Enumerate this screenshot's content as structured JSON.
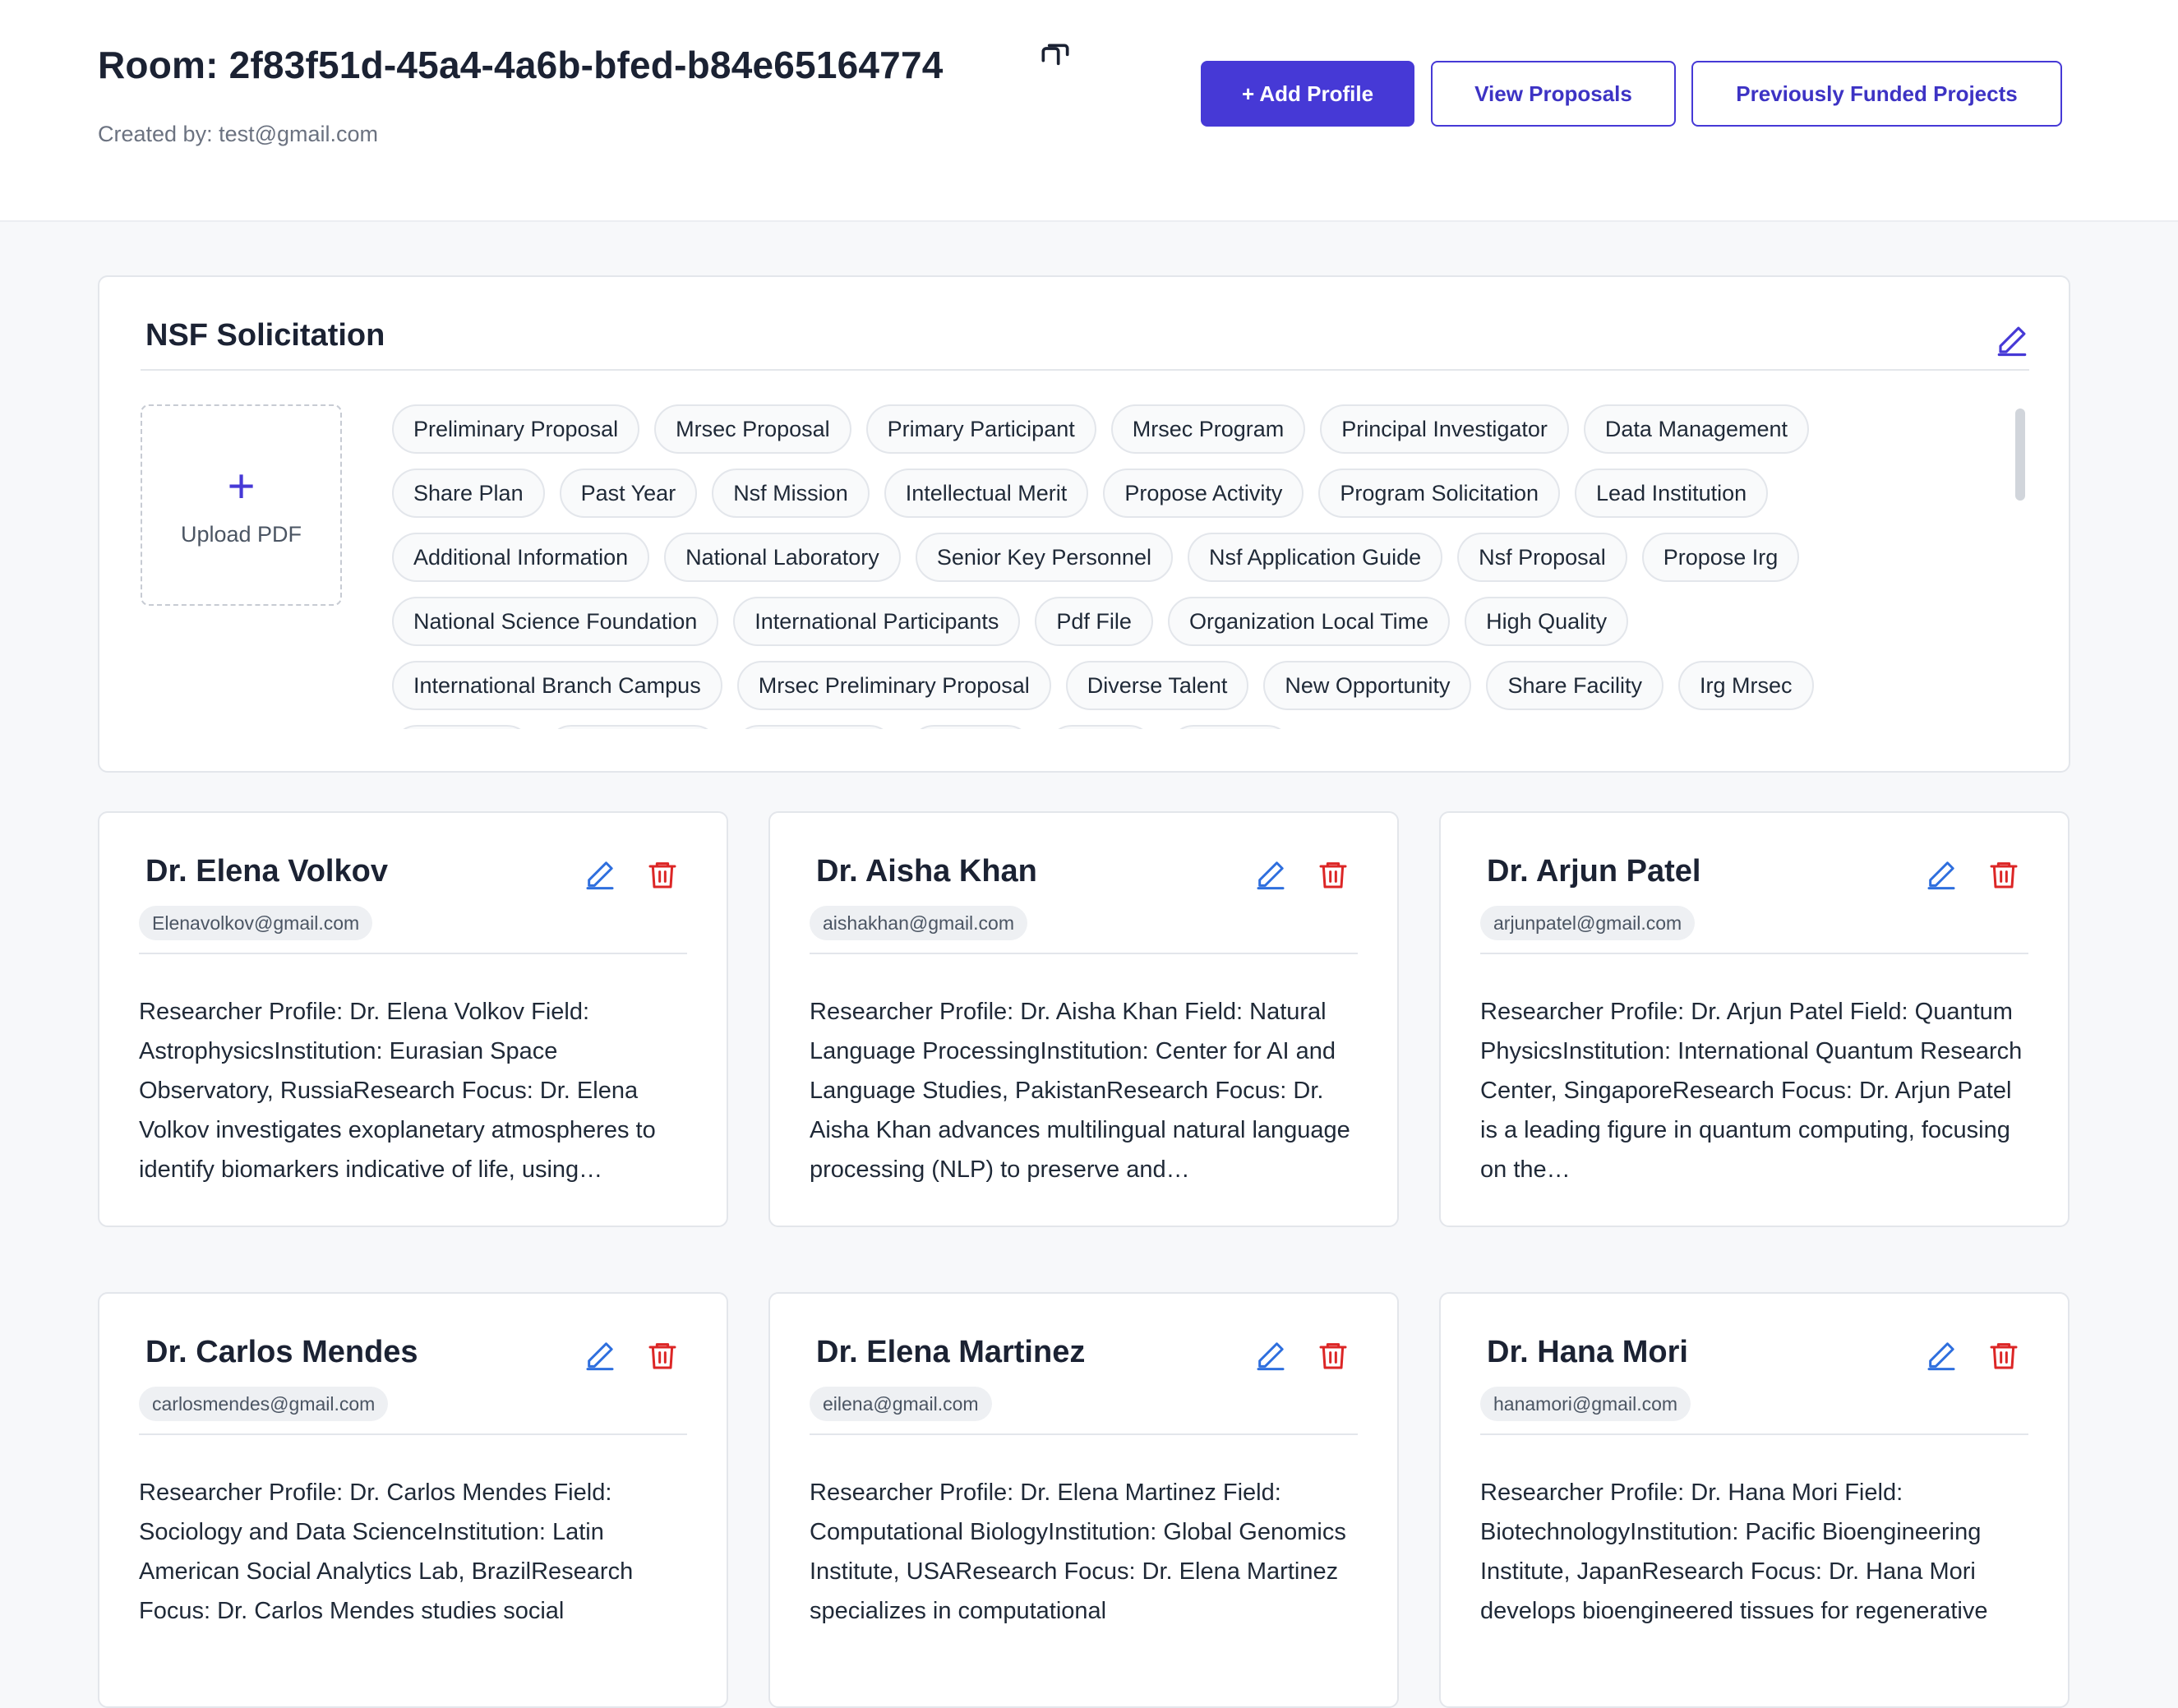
{
  "header": {
    "room_title": "Room: 2f83f51d-45a4-4a6b-bfed-b84e65164774",
    "created_by": "Created by: test@gmail.com",
    "add_profile_label": "+ Add Profile",
    "view_proposals_label": "View Proposals",
    "funded_projects_label": "Previously Funded Projects",
    "accent_color": "#4639d6"
  },
  "solicitation": {
    "title": "NSF Solicitation",
    "upload_plus": "+",
    "upload_label": "Upload PDF",
    "tags": [
      "Preliminary Proposal",
      "Mrsec Proposal",
      "Primary Participant",
      "Mrsec Program",
      "Principal Investigator",
      "Data Management",
      "Share Plan",
      "Past Year",
      "Nsf Mission",
      "Intellectual Merit",
      "Propose Activity",
      "Program Solicitation",
      "Lead Institution",
      "Additional Information",
      "National Laboratory",
      "Senior Key Personnel",
      "Nsf Application Guide",
      "Nsf Proposal",
      "Propose Irg",
      "National Science Foundation",
      "International Participants",
      "Pdf File",
      "Organization Local Time",
      "High Quality",
      "International Branch Campus",
      "Mrsec Preliminary Proposal",
      "Diverse Talent",
      "New Opportunity",
      "Share Facility",
      "Irg Mrsec"
    ]
  },
  "profiles": [
    {
      "name": "Dr. Elena Volkov",
      "email": "Elenavolkov@gmail.com",
      "description": "Researcher Profile: Dr. Elena Volkov Field: AstrophysicsInstitution: Eurasian Space Observatory, RussiaResearch Focus: Dr. Elena Volkov investigates exoplanetary atmospheres to identify biomarkers indicative of life, using…"
    },
    {
      "name": "Dr. Aisha Khan",
      "email": "aishakhan@gmail.com",
      "description": "Researcher Profile: Dr. Aisha Khan Field: Natural Language ProcessingInstitution: Center for AI and Language Studies, PakistanResearch Focus: Dr. Aisha Khan advances multilingual natural language processing (NLP) to preserve and…"
    },
    {
      "name": "Dr. Arjun Patel",
      "email": "arjunpatel@gmail.com",
      "description": "Researcher Profile: Dr. Arjun Patel Field: Quantum PhysicsInstitution: International Quantum Research Center, SingaporeResearch Focus: Dr. Arjun Patel is a leading figure in quantum computing, focusing on the…"
    },
    {
      "name": "Dr. Carlos Mendes",
      "email": "carlosmendes@gmail.com",
      "description": "Researcher Profile: Dr. Carlos Mendes Field: Sociology and Data ScienceInstitution: Latin American Social Analytics Lab, BrazilResearch Focus: Dr. Carlos Mendes studies social"
    },
    {
      "name": "Dr. Elena Martinez",
      "email": "eilena@gmail.com",
      "description": "Researcher Profile: Dr. Elena Martinez Field: Computational BiologyInstitution: Global Genomics Institute, USAResearch Focus: Dr. Elena Martinez specializes in computational"
    },
    {
      "name": "Dr. Hana Mori",
      "email": "hanamori@gmail.com",
      "description": "Researcher Profile: Dr. Hana Mori Field: BiotechnologyInstitution: Pacific Bioengineering Institute, JapanResearch Focus: Dr. Hana Mori develops bioengineered tissues for regenerative"
    }
  ],
  "colors": {
    "edit_icon": "#2f6fde",
    "delete_icon": "#dc2626",
    "accent": "#4639d6"
  },
  "icons": {
    "copy": "copy-icon",
    "edit": "pencil-icon",
    "delete": "trash-icon",
    "upload": "plus-icon"
  }
}
